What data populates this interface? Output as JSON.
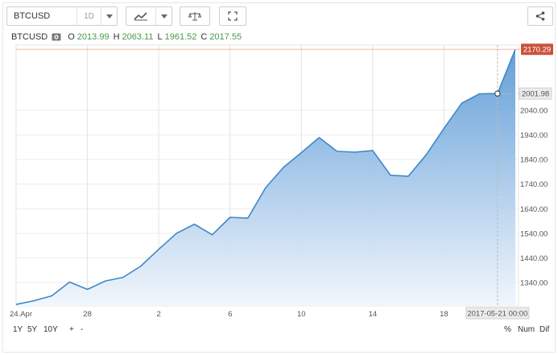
{
  "toolbar": {
    "symbol_value": "BTCUSD",
    "interval": "1D",
    "chart_type_icon": "line-chart-icon",
    "compare_icon": "scales-icon",
    "fullscreen_icon": "expand-icon",
    "share_icon": "share-icon"
  },
  "legend": {
    "symbol": "BTCUSD",
    "open_label": "O",
    "open": "2013.99",
    "high_label": "H",
    "high": "2063.11",
    "low_label": "L",
    "low": "1961.52",
    "close_label": "C",
    "close": "2017.55"
  },
  "colors": {
    "line": "#3f87c9",
    "fill_top": "#5c9ad6",
    "fill_bottom": "#f1f6fc",
    "last_price_badge": "#c9523c",
    "crosshair_badge": "#ebebeb",
    "up": "#4a9a4a"
  },
  "chart_data": {
    "type": "area",
    "x": [
      "2017-04-24",
      "2017-04-25",
      "2017-04-26",
      "2017-04-27",
      "2017-04-28",
      "2017-04-29",
      "2017-04-30",
      "2017-05-01",
      "2017-05-02",
      "2017-05-03",
      "2017-05-04",
      "2017-05-05",
      "2017-05-06",
      "2017-05-07",
      "2017-05-08",
      "2017-05-09",
      "2017-05-10",
      "2017-05-11",
      "2017-05-12",
      "2017-05-13",
      "2017-05-14",
      "2017-05-15",
      "2017-05-16",
      "2017-05-17",
      "2017-05-18",
      "2017-05-19",
      "2017-05-20",
      "2017-05-21",
      "2017-05-22"
    ],
    "values": [
      1251,
      1266,
      1286,
      1342,
      1312,
      1346,
      1361,
      1407,
      1475,
      1540,
      1577,
      1534,
      1605,
      1602,
      1726,
      1808,
      1868,
      1929,
      1873,
      1870,
      1876,
      1776,
      1772,
      1859,
      1966,
      2069,
      2107,
      2108,
      2288
    ],
    "ylim": [
      1245,
      2305
    ],
    "y_ticks": [
      "1340.00",
      "1440.00",
      "1540.00",
      "1640.00",
      "1740.00",
      "1840.00",
      "1940.00",
      "2040.00"
    ],
    "y_tick_values": [
      1340,
      1440,
      1540,
      1640,
      1740,
      1840,
      1940,
      2040
    ],
    "x_ticks": [
      "24.Apr",
      "28",
      "2",
      "6",
      "10",
      "14",
      "18"
    ],
    "x_tick_dates": [
      "2017-04-24",
      "2017-04-28",
      "2017-05-02",
      "2017-05-06",
      "2017-05-10",
      "2017-05-14",
      "2017-05-18"
    ],
    "last_price": "2170.29",
    "last_price_value": 2288,
    "crosshair_price": "2001.98",
    "crosshair_date": "2017-05-21 00:00",
    "crosshair_x": "2017-05-21",
    "crosshair_value": 2108,
    "grid": true,
    "legend": "none"
  },
  "bottom": {
    "ranges": [
      "1Y",
      "5Y",
      "10Y"
    ],
    "zoom_in": "+",
    "zoom_out": "-",
    "modes": [
      "%",
      "Num",
      "Dif"
    ]
  }
}
